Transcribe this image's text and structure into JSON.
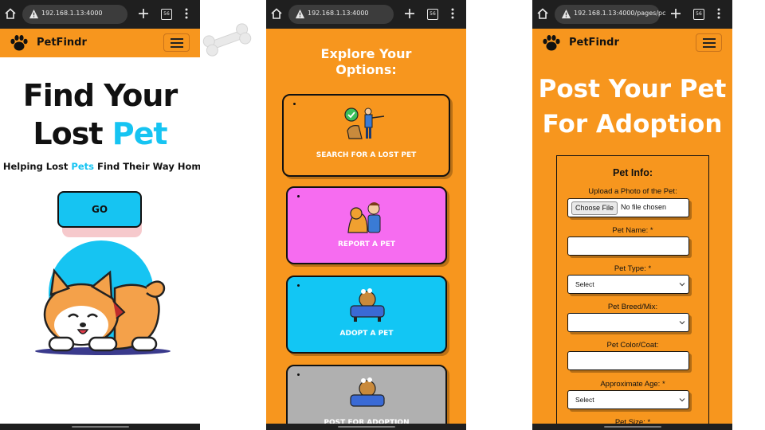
{
  "browser": {
    "url1": "192.168.1.13:4000",
    "url2": "192.168.1.13:4000",
    "url3": "192.168.1.13:4000/pages/pc",
    "tab_count": "56"
  },
  "nav": {
    "brand": "PetFindr"
  },
  "home": {
    "hero_line1": "Find Your",
    "hero_line2_prefix": "Lost ",
    "hero_line2_accent": "Pet",
    "tagline_prefix": "Helping Lost ",
    "tagline_accent": "Pets",
    "tagline_suffix": " Find Their Way Home",
    "go_label": "GO"
  },
  "explore": {
    "title_line1": "Explore Your",
    "title_line2": "Options:",
    "options": [
      {
        "label": "SEARCH FOR A LOST PET",
        "color": "#f7961e"
      },
      {
        "label": "REPORT A PET",
        "color": "#f66cf0"
      },
      {
        "label": "ADOPT A PET",
        "color": "#12c6f4"
      },
      {
        "label": "POST FOR ADOPTION",
        "color": "#b0b0b0"
      }
    ]
  },
  "post": {
    "title_line1": "Post Your Pet",
    "title_line2": "For Adoption",
    "form_title": "Pet Info:",
    "photo_label": "Upload a Photo of the Pet:",
    "choose_file": "Choose File",
    "no_file": "No file chosen",
    "name_label": "Pet Name: *",
    "type_label": "Pet Type: *",
    "type_value": "Select",
    "breed_label": "Pet Breed/Mix:",
    "color_label": "Pet Color/Coat:",
    "age_label": "Approximate Age: *",
    "age_value": "Select",
    "size_label": "Pet Size: *"
  },
  "colors": {
    "orange": "#f7961e",
    "cyan": "#16c4f2",
    "pink": "#f66cf0",
    "gray": "#b0b0b0",
    "chrome": "#1f1f1f"
  }
}
